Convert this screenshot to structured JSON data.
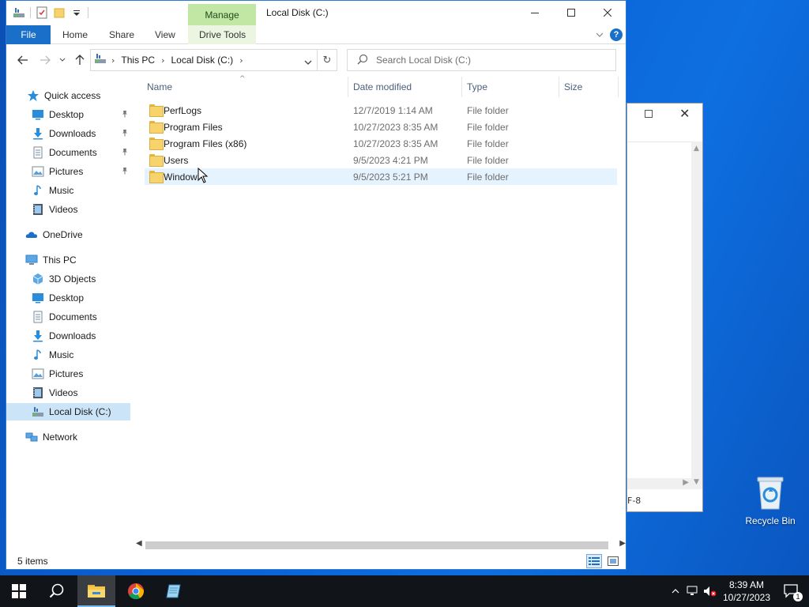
{
  "desktop": {
    "recycle_bin_label": "Recycle Bin",
    "background_window": {
      "status_fragment": "F-8"
    }
  },
  "window": {
    "title": "Local Disk (C:)",
    "contextual_tab_group": "Manage"
  },
  "ribbon": {
    "tabs": [
      {
        "label": "File"
      },
      {
        "label": "Home"
      },
      {
        "label": "Share"
      },
      {
        "label": "View"
      },
      {
        "label": "Drive Tools"
      }
    ]
  },
  "address": {
    "breadcrumbs": [
      "This PC",
      "Local Disk (C:)"
    ],
    "search_placeholder": "Search Local Disk (C:)"
  },
  "nav_pane": {
    "items": [
      {
        "label": "Quick access",
        "icon": "star-icon",
        "pinned": false
      },
      {
        "label": "Desktop",
        "icon": "desktop-icon",
        "pinned": true
      },
      {
        "label": "Downloads",
        "icon": "downloads-icon",
        "pinned": true
      },
      {
        "label": "Documents",
        "icon": "documents-icon",
        "pinned": true
      },
      {
        "label": "Pictures",
        "icon": "pictures-icon",
        "pinned": true
      },
      {
        "label": "Music",
        "icon": "music-icon",
        "pinned": false
      },
      {
        "label": "Videos",
        "icon": "videos-icon",
        "pinned": false
      },
      {
        "label": "OneDrive",
        "icon": "onedrive-icon",
        "pinned": false
      },
      {
        "label": "This PC",
        "icon": "computer-icon",
        "pinned": false
      },
      {
        "label": "3D Objects",
        "icon": "3d-objects-icon",
        "pinned": false
      },
      {
        "label": "Desktop",
        "icon": "desktop-icon",
        "pinned": false
      },
      {
        "label": "Documents",
        "icon": "documents-icon",
        "pinned": false
      },
      {
        "label": "Downloads",
        "icon": "downloads-icon",
        "pinned": false
      },
      {
        "label": "Music",
        "icon": "music-icon",
        "pinned": false
      },
      {
        "label": "Pictures",
        "icon": "pictures-icon",
        "pinned": false
      },
      {
        "label": "Videos",
        "icon": "videos-icon",
        "pinned": false
      },
      {
        "label": "Local Disk (C:)",
        "icon": "drive-icon",
        "pinned": false,
        "selected": true
      },
      {
        "label": "Network",
        "icon": "network-icon",
        "pinned": false
      }
    ]
  },
  "columns": {
    "name": "Name",
    "date_modified": "Date modified",
    "type": "Type",
    "size": "Size"
  },
  "files": [
    {
      "name": "PerfLogs",
      "date": "12/7/2019 1:14 AM",
      "type": "File folder"
    },
    {
      "name": "Program Files",
      "date": "10/27/2023 8:35 AM",
      "type": "File folder"
    },
    {
      "name": "Program Files (x86)",
      "date": "10/27/2023 8:35 AM",
      "type": "File folder"
    },
    {
      "name": "Users",
      "date": "9/5/2023 4:21 PM",
      "type": "File folder"
    },
    {
      "name": "Window",
      "date": "9/5/2023 5:21 PM",
      "type": "File folder",
      "hovered": true
    }
  ],
  "status": {
    "item_count": "5 items"
  },
  "taskbar": {
    "time": "8:39 AM",
    "date": "10/27/2023",
    "notification_count": "1",
    "apps": [
      "start-icon",
      "search-icon",
      "file-explorer-icon",
      "chrome-icon",
      "notepad-icon"
    ]
  },
  "colors": {
    "accent": "#1a6fc9",
    "manage_tab": "#c2e6a4",
    "selection": "#cce4f7",
    "hover": "#e5f3ff",
    "taskbar": "#111418"
  }
}
